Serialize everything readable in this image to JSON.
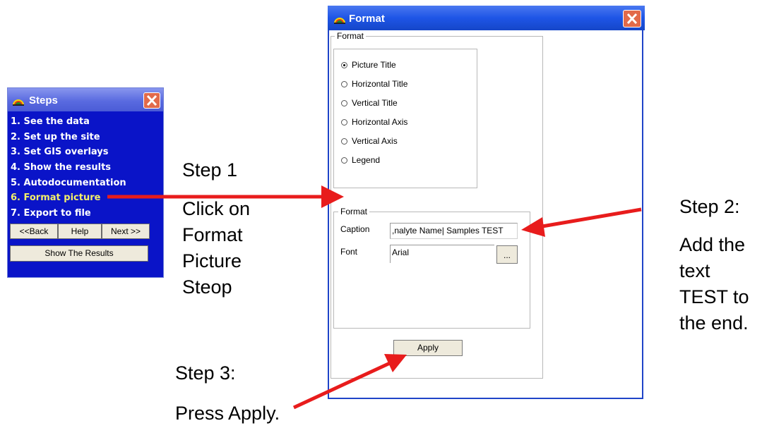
{
  "steps_window": {
    "title": "Steps",
    "items": [
      {
        "label": "1.  See the data",
        "active": false
      },
      {
        "label": "2.  Set up the site",
        "active": false
      },
      {
        "label": "3.  Set GIS overlays",
        "active": false
      },
      {
        "label": "4.  Show the results",
        "active": false
      },
      {
        "label": "5.  Autodocumentation",
        "active": false
      },
      {
        "label": "6.  Format picture",
        "active": true
      },
      {
        "label": "7.  Export to file",
        "active": false
      }
    ],
    "back_label": "<<Back",
    "help_label": "Help",
    "next_label": "Next >>",
    "show_results_label": "Show The Results",
    "active_color": "#f2ef6a",
    "background_color": "#0a14c8"
  },
  "format_window": {
    "title": "Format",
    "outer_group_label": "Format",
    "radio_options": [
      {
        "label": "Picture Title",
        "checked": true
      },
      {
        "label": "Horizontal Title",
        "checked": false
      },
      {
        "label": "Vertical Title",
        "checked": false
      },
      {
        "label": "Horizontal Axis",
        "checked": false
      },
      {
        "label": "Vertical Axis",
        "checked": false
      },
      {
        "label": "Legend",
        "checked": false
      }
    ],
    "inner_group_label": "Format",
    "caption_label": "Caption",
    "caption_value": ",nalyte Name| Samples TEST",
    "font_label": "Font",
    "font_value": "Arial",
    "browse_label": "...",
    "apply_label": "Apply"
  },
  "annotations": {
    "step1": [
      "Step 1",
      "Click on",
      "Format",
      "Picture",
      "Steop"
    ],
    "step2": [
      "Step 2:",
      "Add the",
      "text",
      "TEST to",
      "the end."
    ],
    "step3_title": "Step 3:",
    "step3_text": "Press Apply."
  },
  "colors": {
    "arrow": "#e81c1c",
    "titlebar_blue": "#1e55e6",
    "close_red": "#e26a4a"
  }
}
